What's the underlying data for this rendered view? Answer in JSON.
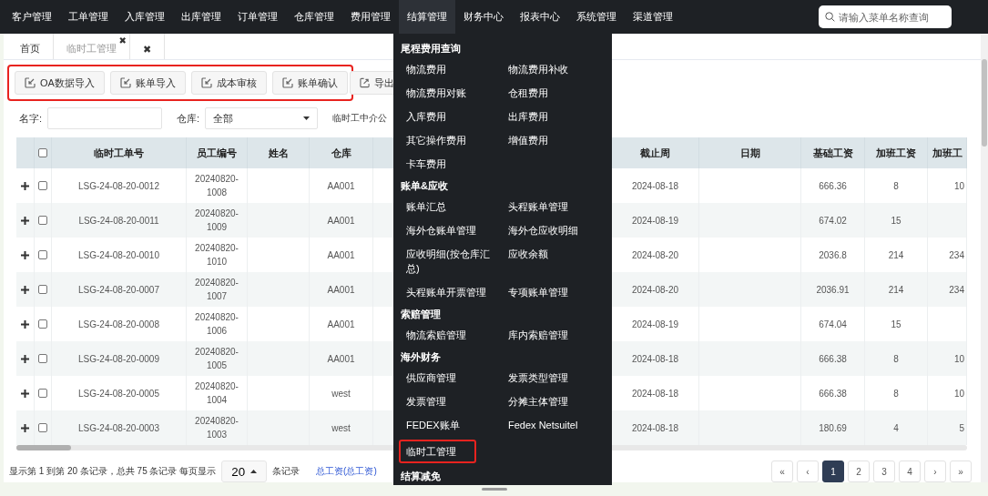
{
  "nav": {
    "items": [
      {
        "label": "客户管理",
        "selected": false
      },
      {
        "label": "工单管理",
        "selected": false
      },
      {
        "label": "入库管理",
        "selected": false
      },
      {
        "label": "出库管理",
        "selected": false
      },
      {
        "label": "订单管理",
        "selected": false
      },
      {
        "label": "仓库管理",
        "selected": false
      },
      {
        "label": "费用管理",
        "selected": false
      },
      {
        "label": "结算管理",
        "selected": true
      },
      {
        "label": "财务中心",
        "selected": false
      },
      {
        "label": "报表中心",
        "selected": false
      },
      {
        "label": "系统管理",
        "selected": false
      },
      {
        "label": "渠道管理",
        "selected": false
      }
    ],
    "search": {
      "placeholder": "请输入菜单名称查询"
    }
  },
  "tabs": [
    {
      "label": "首页",
      "selected": false
    },
    {
      "label": "临时工管理",
      "selected": true,
      "close": "✖"
    },
    {
      "label": "✖",
      "selected": false
    }
  ],
  "toolbar": {
    "highlighted": true,
    "buttons": [
      {
        "label": "OA数据导入",
        "kind": "import"
      },
      {
        "label": "账单导入",
        "kind": "import"
      },
      {
        "label": "成本审核",
        "kind": "import"
      },
      {
        "label": "账单确认",
        "kind": "import"
      }
    ],
    "extra_button": {
      "label": "导出",
      "kind": "export"
    }
  },
  "filters": {
    "name_label": "名字:",
    "warehouse_label": "仓库:",
    "warehouse_value": "全部",
    "agency_label": "临时工中介公"
  },
  "table": {
    "header_checked": false,
    "columns": [
      "临时工单号",
      "员工编号",
      "姓名",
      "仓库",
      "截止周",
      "日期",
      "基础工资",
      "加班工资",
      "加班工"
    ],
    "rows": [
      {
        "checked": false,
        "order_no": "LSG-24-08-20-0012",
        "employee_no": "20240820-1008",
        "warehouse": "AA001",
        "week_end": "2024-08-18",
        "base_pay": "666.36",
        "overtime_pay": "8",
        "column_9": "10"
      },
      {
        "checked": false,
        "order_no": "LSG-24-08-20-0011",
        "employee_no": "20240820-1009",
        "warehouse": "AA001",
        "week_end": "2024-08-19",
        "base_pay": "674.02",
        "overtime_pay": "15"
      },
      {
        "checked": false,
        "order_no": "LSG-24-08-20-0010",
        "employee_no": "20240820-1010",
        "warehouse": "AA001",
        "week_end": "2024-08-20",
        "base_pay": "2036.8",
        "overtime_pay": "214",
        "column_9": "234"
      },
      {
        "checked": false,
        "order_no": "LSG-24-08-20-0007",
        "employee_no": "20240820-1007",
        "warehouse": "AA001",
        "week_end": "2024-08-20",
        "base_pay": "2036.91",
        "overtime_pay": "214",
        "column_9": "234"
      },
      {
        "checked": false,
        "order_no": "LSG-24-08-20-0008",
        "employee_no": "20240820-1006",
        "warehouse": "AA001",
        "week_end": "2024-08-19",
        "base_pay": "674.04",
        "overtime_pay": "15"
      },
      {
        "checked": false,
        "order_no": "LSG-24-08-20-0009",
        "employee_no": "20240820-1005",
        "warehouse": "AA001",
        "week_end": "2024-08-18",
        "base_pay": "666.38",
        "overtime_pay": "8",
        "column_9": "10"
      },
      {
        "checked": false,
        "order_no": "LSG-24-08-20-0005",
        "employee_no": "20240820-1004",
        "warehouse": "west",
        "week_end": "2024-08-18",
        "base_pay": "666.38",
        "overtime_pay": "8",
        "column_9": "10"
      },
      {
        "checked": false,
        "order_no": "LSG-24-08-20-0003",
        "employee_no": "20240820-1003",
        "warehouse": "west",
        "week_end": "2024-08-18",
        "base_pay": "180.69",
        "overtime_pay": "4",
        "column_9": "5"
      }
    ]
  },
  "footer": {
    "info": "显示第 1 到第 20 条记录，总共 75 条记录 每页显示",
    "page_size": "20",
    "suffix": "条记录",
    "link": "总工资(总工资)",
    "pages": [
      {
        "label": "«",
        "selected": false
      },
      {
        "label": "‹",
        "selected": false
      },
      {
        "label": "1",
        "selected": true
      },
      {
        "label": "2",
        "selected": false
      },
      {
        "label": "3",
        "selected": false
      },
      {
        "label": "4",
        "selected": false
      },
      {
        "label": "›",
        "selected": false
      },
      {
        "label": "»",
        "selected": false
      }
    ]
  },
  "menu": {
    "groups": [
      {
        "title": "尾程费用查询",
        "items": [
          {
            "label": "物流费用",
            "highlighted": false
          },
          {
            "label": "物流费用补收",
            "highlighted": false
          },
          {
            "label": "物流费用对账",
            "highlighted": false
          },
          {
            "label": "仓租费用",
            "highlighted": false
          },
          {
            "label": "入库费用",
            "highlighted": false
          },
          {
            "label": "出库费用",
            "highlighted": false
          },
          {
            "label": "其它操作费用",
            "highlighted": false
          },
          {
            "label": "增值费用",
            "highlighted": false
          },
          {
            "label": "卡车费用",
            "highlighted": false
          }
        ]
      },
      {
        "title": "账单&应收",
        "items": [
          {
            "label": "账单汇总",
            "highlighted": false
          },
          {
            "label": "头程账单管理",
            "highlighted": false
          },
          {
            "label": "海外仓账单管理",
            "highlighted": false
          },
          {
            "label": "海外仓应收明细",
            "highlighted": false
          },
          {
            "label": "应收明细(按仓库汇总)",
            "highlighted": false
          },
          {
            "label": "应收余额",
            "highlighted": false
          },
          {
            "label": "头程账单开票管理",
            "highlighted": false
          },
          {
            "label": "专项账单管理",
            "highlighted": false
          }
        ]
      },
      {
        "title": "索赔管理",
        "items": [
          {
            "label": "物流索赔管理",
            "highlighted": false
          },
          {
            "label": "库内索赔管理",
            "highlighted": false
          }
        ]
      },
      {
        "title": "海外财务",
        "items": [
          {
            "label": "供应商管理",
            "highlighted": false
          },
          {
            "label": "发票类型管理",
            "highlighted": false
          },
          {
            "label": "发票管理",
            "highlighted": false
          },
          {
            "label": "分摊主体管理",
            "highlighted": false
          },
          {
            "label": "FEDEX账单",
            "highlighted": false
          },
          {
            "label": "Fedex Netsuitel",
            "highlighted": false
          },
          {
            "label": "临时工管理",
            "highlighted": true
          }
        ]
      },
      {
        "title": "结算减免"
      }
    ]
  }
}
